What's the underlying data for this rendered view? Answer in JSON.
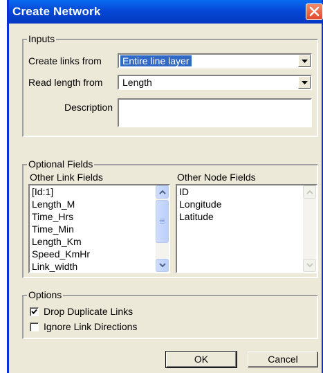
{
  "window": {
    "title": "Create Network"
  },
  "inputs": {
    "legend": "Inputs",
    "create_links_label": "Create links from",
    "create_links_value": "Entire line layer",
    "read_length_label": "Read length from",
    "read_length_value": "Length",
    "description_label": "Description",
    "description_value": ""
  },
  "optional": {
    "legend": "Optional Fields",
    "link_fields_label": "Other Link Fields",
    "node_fields_label": "Other Node Fields",
    "link_fields": [
      "[Id:1]",
      "Length_M",
      "Time_Hrs",
      "Time_Min",
      "Length_Km",
      "Speed_KmHr",
      "Link_width"
    ],
    "node_fields": [
      "ID",
      "Longitude",
      "Latitude"
    ]
  },
  "options": {
    "legend": "Options",
    "drop_duplicates_label": "Drop Duplicate Links",
    "drop_duplicates_checked": true,
    "ignore_directions_label": "Ignore Link Directions",
    "ignore_directions_checked": false
  },
  "buttons": {
    "ok": "OK",
    "cancel": "Cancel"
  },
  "colors": {
    "titlebar": "#0548d6",
    "dialog_bg": "#ece9d8",
    "selection": "#316ac5",
    "close": "#e0482a"
  },
  "icons": {
    "close": "close-icon",
    "dropdown": "chevron-down-icon",
    "scroll_up": "chevron-up-icon",
    "scroll_down": "chevron-down-icon",
    "check": "check-icon"
  }
}
